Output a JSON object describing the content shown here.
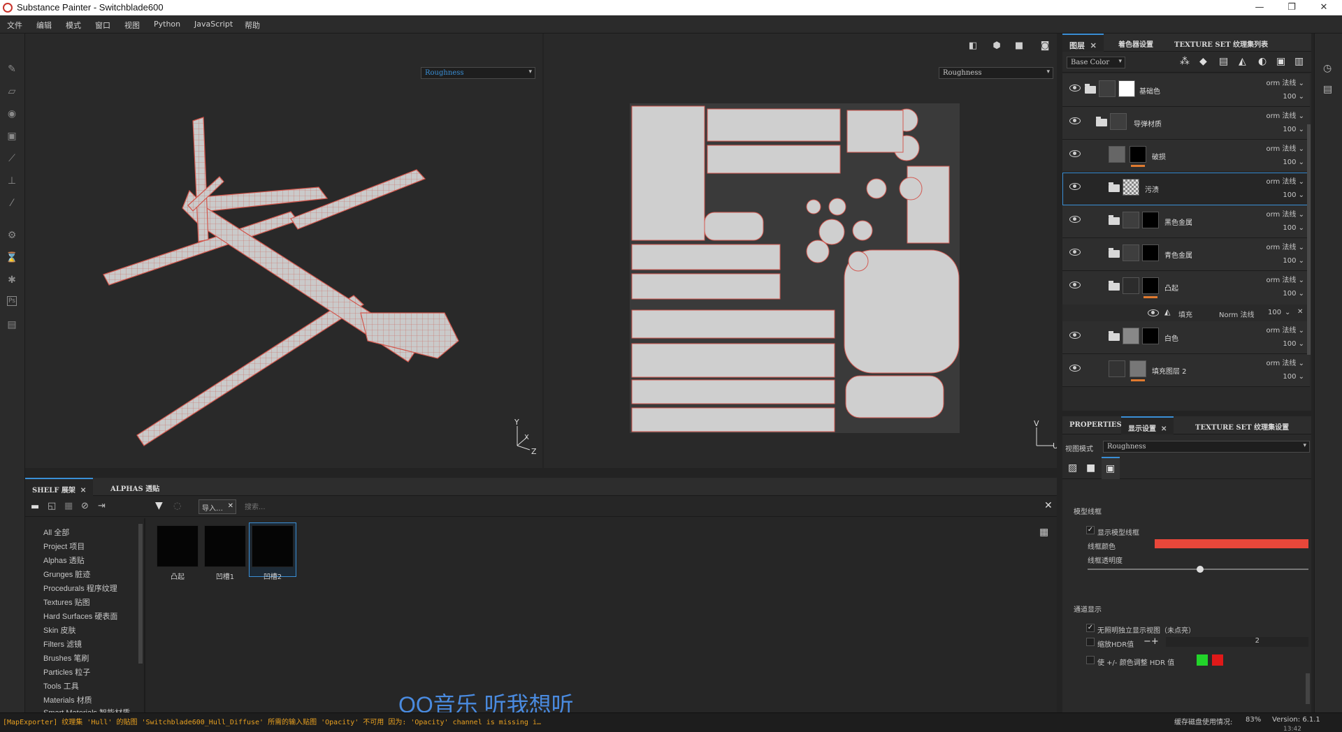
{
  "window": {
    "title": "Substance Painter - Switchblade600",
    "minimize": "—",
    "maximize": "❐",
    "close": "✕"
  },
  "menu": [
    "文件",
    "编辑",
    "模式",
    "窗口",
    "视图",
    "Python",
    "JavaScript",
    "帮助"
  ],
  "viewport": {
    "left_channel": "Roughness",
    "right_channel": "Roughness",
    "axis_left": {
      "y": "Y",
      "x": "X",
      "z": "Z"
    },
    "axis_right": {
      "v": "V",
      "u": "U"
    }
  },
  "shelf": {
    "tabs": [
      "SHELF 展架",
      "ALPHAS 透贴"
    ],
    "filter_chip": "导入…",
    "search_placeholder": "搜索...",
    "categories": [
      "All 全部",
      "Project 项目",
      "Alphas 透贴",
      "Grunges 脏迹",
      "Procedurals 程序纹理",
      "Textures 贴图",
      "Hard Surfaces 硬表面",
      "Skin 皮肤",
      "Filters 滤镜",
      "Brushes 笔刷",
      "Particles 粒子",
      "Tools 工具",
      "Materials 材质",
      "Smart Materials 智能材质"
    ],
    "items": [
      "凸起",
      "凹槽1",
      "凹槽2"
    ]
  },
  "layers_panel": {
    "tabs": [
      "图层",
      "着色器设置",
      "TEXTURE SET 纹理集列表"
    ],
    "channel": "Base Color",
    "rows": [
      {
        "name": "基础色",
        "blend": "orm 法线",
        "opacity": "100"
      },
      {
        "name": "导弹材质",
        "blend": "orm 法线",
        "opacity": "100"
      },
      {
        "name": "破损",
        "blend": "orm 法线",
        "opacity": "100"
      },
      {
        "name": "污渍",
        "blend": "orm 法线",
        "opacity": "100"
      },
      {
        "name": "黑色金属",
        "blend": "orm 法线",
        "opacity": "100"
      },
      {
        "name": "青色金属",
        "blend": "orm 法线",
        "opacity": "100"
      },
      {
        "name": "凸起",
        "blend": "orm 法线",
        "opacity": "100"
      },
      {
        "name": "白色",
        "blend": "orm 法线",
        "opacity": "100"
      },
      {
        "name": "填充图层 2",
        "blend": "orm 法线",
        "opacity": "100"
      }
    ],
    "effect": {
      "name": "填充",
      "blend": "Norm 法线",
      "opacity": "100"
    }
  },
  "properties_panel": {
    "tabs": [
      "PROPERTIES",
      "显示设置",
      "TEXTURE SET 纹理集设置"
    ],
    "view_mode_label": "视图模式",
    "view_mode": "Roughness",
    "section_wireframe": "模型线框",
    "show_wireframe": "显示模型线框",
    "wire_color_label": "线框颜色",
    "wire_opacity_label": "线框透明度",
    "section_channel": "通道显示",
    "opt1": "无照明独立显示视图（未点亮）",
    "opt2": "缩放HDR值",
    "opt2_value": "2",
    "opt3": "使 +/- 颜色调整 HDR 值",
    "colors": {
      "wire": "#e8473a",
      "green": "#22d42a",
      "red": "#e01919",
      "accent": "#3a8fd6"
    }
  },
  "status": {
    "log": "[MapExporter] 纹理集 'Hull' 的贴图 'Switchblade600_Hull_Diffuse' 所需的输入贴图 'Opacity' 不可用 因为: 'Opacity' channel is missing i…",
    "cache": "缓存磁盘使用情况:",
    "cache_value": "83%",
    "version": "Version: 6.1.1",
    "time": "13:42"
  },
  "overlay_text": "QQ音乐 听我想听"
}
